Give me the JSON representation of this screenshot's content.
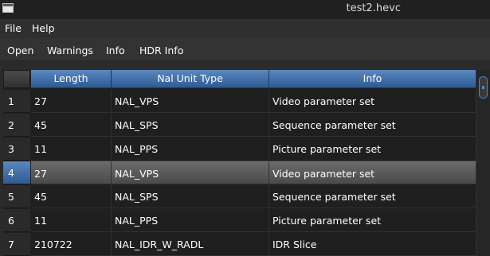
{
  "window": {
    "title": "test2.hevc"
  },
  "menubar": {
    "items": [
      "File",
      "Help"
    ]
  },
  "toolbar": {
    "items": [
      "Open",
      "Warnings",
      "Info",
      "HDR Info"
    ]
  },
  "table": {
    "columns": [
      "Length",
      "Nal Unit Type",
      "Info"
    ],
    "selected_row": 4,
    "rows": [
      {
        "num": "1",
        "length": "27",
        "type": "NAL_VPS",
        "info": "Video parameter set"
      },
      {
        "num": "2",
        "length": "45",
        "type": "NAL_SPS",
        "info": "Sequence parameter set"
      },
      {
        "num": "3",
        "length": "11",
        "type": "NAL_PPS",
        "info": "Picture parameter set"
      },
      {
        "num": "4",
        "length": "27",
        "type": "NAL_VPS",
        "info": "Video parameter set"
      },
      {
        "num": "5",
        "length": "45",
        "type": "NAL_SPS",
        "info": "Sequence parameter set"
      },
      {
        "num": "6",
        "length": "11",
        "type": "NAL_PPS",
        "info": "Picture parameter set"
      },
      {
        "num": "7",
        "length": "210722",
        "type": "NAL_IDR_W_RADL",
        "info": "IDR Slice"
      }
    ]
  },
  "colors": {
    "header": "#3f6ea8",
    "selected_row": "#5a5a5a",
    "background": "#1f1f1f"
  }
}
